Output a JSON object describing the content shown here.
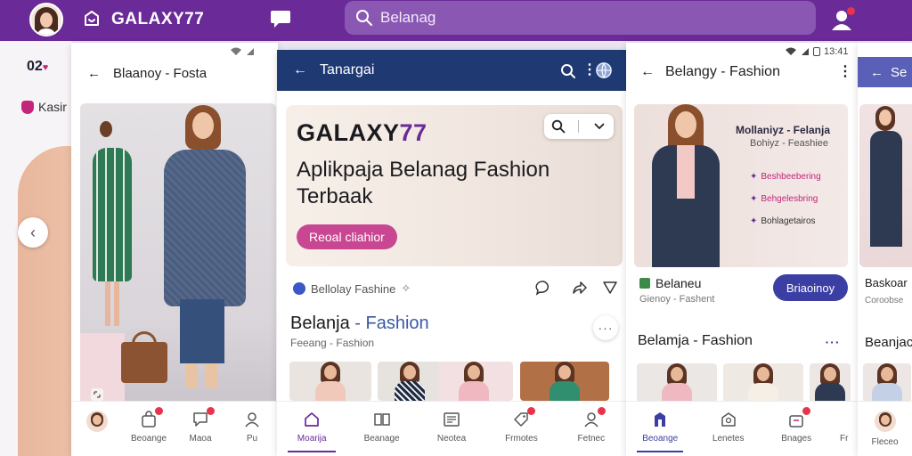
{
  "topbar": {
    "brand": "GALAXY77",
    "search_placeholder": "Belanag"
  },
  "left_panel": {
    "time": "02",
    "item_label": "Kasir"
  },
  "screen_a": {
    "title": "Blaanoy - Fosta",
    "nav": [
      "",
      "Beoange",
      "Maoa",
      "Pu"
    ]
  },
  "screen_b": {
    "header_title": "Tanargai",
    "hero_brand_main": "GALAXY",
    "hero_brand_accent": "77",
    "hero_title": "Aplikpaja Belanag Fashion Terbaak",
    "hero_cta": "Reoal cliahior",
    "meta_text": "Bellolay Fashine",
    "section_title_main": "Belanja",
    "section_title_accent": "- Fashion",
    "section_subtitle": "Feeang - Fashion",
    "nav": [
      "Moarija",
      "Beanage",
      "Neotea",
      "Frmotes",
      "Fetnec"
    ]
  },
  "screen_c": {
    "status_time": "13:41",
    "header_title": "Belangy - Fashion",
    "card_title": "Mollaniyz - Felanja",
    "card_subtitle": "Bohiyz - Feashiee",
    "card_bullets": [
      "Beshbeebering",
      "Behgelesbring",
      "Bohlagetairos"
    ],
    "product_name": "Belaneu",
    "product_subtitle": "Gienoy - Fashent",
    "product_button": "Briaoinoy",
    "section_title": "Belamja - Fashion",
    "nav": [
      "Beoange",
      "Lenetes",
      "Bnages",
      "Fr"
    ]
  },
  "screen_d": {
    "header_title": "Se",
    "product_name": "Baskoar",
    "product_subtitle": "Coroobse",
    "section_title": "Beanjac",
    "nav": [
      "Fleceo"
    ]
  },
  "colors": {
    "brand_purple": "#6a2a97",
    "navy_header": "#1f3a73",
    "indigo_button": "#3b3fa4",
    "pink_cta": "#c94792",
    "notification_red": "#e8344a"
  }
}
